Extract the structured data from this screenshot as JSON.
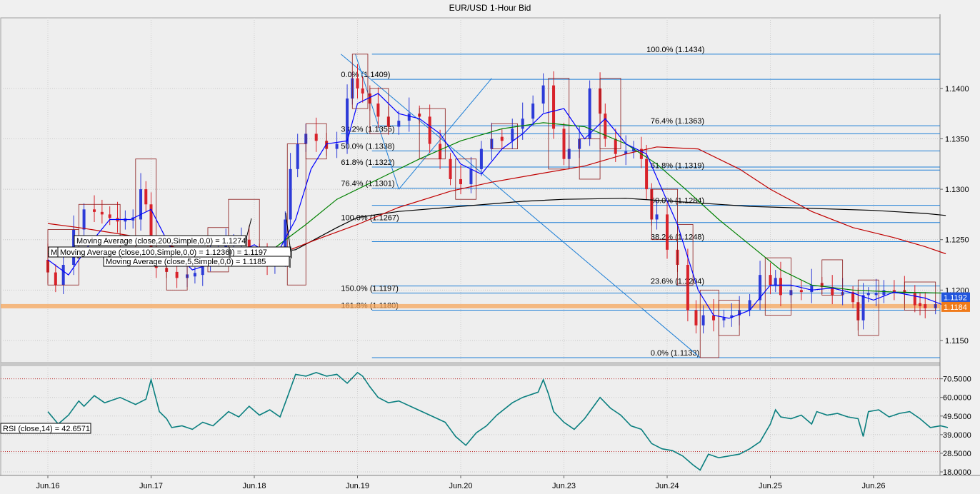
{
  "chart_data": {
    "type": "candlestick",
    "title": "EUR/USD 1-Hour Bid",
    "price_axis": {
      "range": [
        1.1128,
        1.147
      ],
      "ticks": [
        "1.1150",
        "1.1200",
        "1.1250",
        "1.1300",
        "1.1350",
        "1.1400"
      ],
      "current_label": "1.1184",
      "ma_label": "1.1192"
    },
    "rsi_axis": {
      "range": [
        16,
        78
      ],
      "ticks": [
        "18.0000",
        "28.5000",
        "39.0000",
        "49.5000",
        "60.0000",
        "70.5000"
      ],
      "levels": [
        70.5,
        29.5
      ]
    },
    "x_axis_labels": [
      "Jun.16",
      "Jun.17",
      "Jun.18",
      "Jun.19",
      "Jun.20",
      "Jun.23",
      "Jun.24",
      "Jun.25",
      "Jun.26"
    ],
    "x_range": [
      0,
      9.12
    ],
    "fib_lines": [
      {
        "price": 1.1434,
        "label": "100.0%  (1.1434)",
        "x_start": 3.14,
        "label_x": 5.8
      },
      {
        "price": 1.1409,
        "label": "0.0%  (1.1409)",
        "x_start": 3.14,
        "label_x": 2.84
      },
      {
        "price": 1.1363,
        "label": "76.4%  (1.1363)",
        "x_start": 3.14,
        "label_x": 5.84
      },
      {
        "price": 1.1355,
        "label": "38.2%  (1.1355)",
        "x_start": 2.84,
        "label_x": 2.84
      },
      {
        "price": 1.1338,
        "label": "50.0%  (1.1338)",
        "x_start": 3.14,
        "label_x": 2.84
      },
      {
        "price": 1.1322,
        "label": "61.8%  (1.1322)",
        "x_start": 3.14,
        "label_x": 2.84
      },
      {
        "price": 1.1319,
        "label": "61.8%  (1.1319)",
        "x_start": 5.8,
        "label_x": 5.84
      },
      {
        "price": 1.1301,
        "label": "76.4%  (1.1301)",
        "x_start": 3.14,
        "label_x": 2.84
      },
      {
        "price": 1.1284,
        "label": "50.0%  (1.1284)",
        "x_start": 3.14,
        "label_x": 5.84
      },
      {
        "price": 1.1267,
        "label": "100.0%  (1.1267)",
        "x_start": 3.14,
        "label_x": 2.84
      },
      {
        "price": 1.1248,
        "label": "38.2%  (1.1248)",
        "x_start": 3.14,
        "label_x": 5.84
      },
      {
        "price": 1.1204,
        "label": "23.6%  (1.1204)",
        "x_start": 3.14,
        "label_x": 5.84
      },
      {
        "price": 1.1197,
        "label": "150.0%  (1.1197)",
        "x_start": 3.14,
        "label_x": 2.84
      },
      {
        "price": 1.118,
        "label": "161.8%  (1.1180)",
        "x_start": 3.14,
        "label_x": 2.84
      },
      {
        "price": 1.1133,
        "label": "0.0%  (1.1133)",
        "x_start": 3.14,
        "label_x": 5.84
      }
    ],
    "close_path": [
      [
        0.0,
        1.123
      ],
      [
        0.15,
        1.1205
      ],
      [
        0.25,
        1.1225
      ],
      [
        0.35,
        1.126
      ],
      [
        0.45,
        1.128
      ],
      [
        0.6,
        1.1275
      ],
      [
        0.75,
        1.1268
      ],
      [
        0.9,
        1.127
      ],
      [
        0.95,
        1.13
      ],
      [
        1.0,
        1.1285
      ],
      [
        1.05,
        1.124
      ],
      [
        1.15,
        1.1222
      ],
      [
        1.25,
        1.1218
      ],
      [
        1.35,
        1.1212
      ],
      [
        1.5,
        1.1215
      ],
      [
        1.65,
        1.1238
      ],
      [
        1.8,
        1.1245
      ],
      [
        1.95,
        1.125
      ],
      [
        2.05,
        1.124
      ],
      [
        2.2,
        1.1225
      ],
      [
        2.3,
        1.123
      ],
      [
        2.35,
        1.127
      ],
      [
        2.42,
        1.132
      ],
      [
        2.5,
        1.1345
      ],
      [
        2.6,
        1.1355
      ],
      [
        2.7,
        1.1348
      ],
      [
        2.8,
        1.134
      ],
      [
        2.9,
        1.1345
      ],
      [
        2.95,
        1.139
      ],
      [
        3.0,
        1.141
      ],
      [
        3.05,
        1.14
      ],
      [
        3.12,
        1.1395
      ],
      [
        3.2,
        1.1385
      ],
      [
        3.3,
        1.1372
      ],
      [
        3.4,
        1.1362
      ],
      [
        3.5,
        1.1368
      ],
      [
        3.6,
        1.1375
      ],
      [
        3.7,
        1.1372
      ],
      [
        3.8,
        1.1345
      ],
      [
        3.9,
        1.133
      ],
      [
        4.0,
        1.131
      ],
      [
        4.1,
        1.1305
      ],
      [
        4.2,
        1.132
      ],
      [
        4.3,
        1.134
      ],
      [
        4.4,
        1.135
      ],
      [
        4.5,
        1.1348
      ],
      [
        4.6,
        1.136
      ],
      [
        4.7,
        1.137
      ],
      [
        4.8,
        1.1385
      ],
      [
        4.9,
        1.1403
      ],
      [
        5.0,
        1.136
      ],
      [
        5.05,
        1.133
      ],
      [
        5.15,
        1.134
      ],
      [
        5.25,
        1.135
      ],
      [
        5.35,
        1.14
      ],
      [
        5.4,
        1.1375
      ],
      [
        5.5,
        1.135
      ],
      [
        5.6,
        1.1335
      ],
      [
        5.75,
        1.134
      ],
      [
        5.8,
        1.133
      ],
      [
        5.85,
        1.13
      ],
      [
        5.9,
        1.127
      ],
      [
        6.0,
        1.1275
      ],
      [
        6.1,
        1.124
      ],
      [
        6.2,
        1.1225
      ],
      [
        6.28,
        1.118
      ],
      [
        6.35,
        1.1165
      ],
      [
        6.45,
        1.1175
      ],
      [
        6.55,
        1.117
      ],
      [
        6.7,
        1.1175
      ],
      [
        6.8,
        1.118
      ],
      [
        6.9,
        1.119
      ],
      [
        7.0,
        1.1215
      ],
      [
        7.05,
        1.1205
      ],
      [
        7.1,
        1.1212
      ],
      [
        7.2,
        1.1195
      ],
      [
        7.3,
        1.12
      ],
      [
        7.4,
        1.1198
      ],
      [
        7.5,
        1.1205
      ],
      [
        7.6,
        1.1203
      ],
      [
        7.7,
        1.1195
      ],
      [
        7.8,
        1.1198
      ],
      [
        7.85,
        1.1188
      ],
      [
        7.9,
        1.117
      ],
      [
        7.95,
        1.1195
      ],
      [
        8.1,
        1.1195
      ],
      [
        8.2,
        1.12
      ],
      [
        8.3,
        1.1198
      ],
      [
        8.4,
        1.1197
      ],
      [
        8.45,
        1.1185
      ],
      [
        8.5,
        1.1184
      ],
      [
        8.6,
        1.1182
      ],
      [
        8.68,
        1.1184
      ]
    ],
    "series": [
      {
        "name": "Moving Average (close,200,Simple,0,0) = 1.1274",
        "color": "#000000",
        "points": [
          [
            0.0,
            1.1236
          ],
          [
            0.6,
            1.1236
          ],
          [
            1.2,
            1.1233
          ],
          [
            1.8,
            1.1232
          ],
          [
            2.4,
            1.124
          ],
          [
            2.8,
            1.1262
          ],
          [
            3.0,
            1.1272
          ],
          [
            3.4,
            1.1278
          ],
          [
            4.0,
            1.1283
          ],
          [
            4.6,
            1.1288
          ],
          [
            5.0,
            1.129
          ],
          [
            5.6,
            1.1291
          ],
          [
            6.2,
            1.1287
          ],
          [
            6.8,
            1.1283
          ],
          [
            7.4,
            1.1281
          ],
          [
            8.0,
            1.1279
          ],
          [
            8.5,
            1.1276
          ],
          [
            8.7,
            1.1274
          ]
        ]
      },
      {
        "name": "Moving Average (close,100,Simple,0,0) = 1.1236",
        "color": "#c00000",
        "points": [
          [
            0.0,
            1.1266
          ],
          [
            0.3,
            1.1262
          ],
          [
            0.8,
            1.1254
          ],
          [
            1.4,
            1.1238
          ],
          [
            1.9,
            1.1237
          ],
          [
            2.3,
            1.1238
          ],
          [
            2.6,
            1.125
          ],
          [
            3.0,
            1.1265
          ],
          [
            3.4,
            1.1282
          ],
          [
            3.9,
            1.1298
          ],
          [
            4.3,
            1.1307
          ],
          [
            4.8,
            1.1316
          ],
          [
            5.2,
            1.1323
          ],
          [
            5.6,
            1.1335
          ],
          [
            5.9,
            1.1342
          ],
          [
            6.3,
            1.134
          ],
          [
            6.7,
            1.132
          ],
          [
            7.0,
            1.13
          ],
          [
            7.4,
            1.1278
          ],
          [
            7.8,
            1.1262
          ],
          [
            8.2,
            1.1252
          ],
          [
            8.5,
            1.1243
          ],
          [
            8.7,
            1.1236
          ]
        ]
      },
      {
        "name": "Moving Average (close,50,Simple,0,0) = 1.1197",
        "color": "#008000",
        "points": [
          [
            0.0,
            1.1238
          ],
          [
            0.5,
            1.1235
          ],
          [
            1.0,
            1.1237
          ],
          [
            1.4,
            1.124
          ],
          [
            1.8,
            1.1238
          ],
          [
            2.2,
            1.1242
          ],
          [
            2.5,
            1.1265
          ],
          [
            2.8,
            1.129
          ],
          [
            3.2,
            1.131
          ],
          [
            3.6,
            1.133
          ],
          [
            4.0,
            1.1348
          ],
          [
            4.4,
            1.136
          ],
          [
            4.8,
            1.1366
          ],
          [
            5.2,
            1.1362
          ],
          [
            5.6,
            1.1345
          ],
          [
            5.9,
            1.1325
          ],
          [
            6.2,
            1.1298
          ],
          [
            6.5,
            1.127
          ],
          [
            6.8,
            1.1245
          ],
          [
            7.1,
            1.122
          ],
          [
            7.4,
            1.1205
          ],
          [
            7.8,
            1.12
          ],
          [
            8.2,
            1.1198
          ],
          [
            8.7,
            1.1197
          ]
        ]
      },
      {
        "name": "Moving Average (close,5,Simple,0,0) = 1.1185",
        "color": "#0000ff",
        "points": [
          [
            0.0,
            1.123
          ],
          [
            0.2,
            1.1215
          ],
          [
            0.4,
            1.1245
          ],
          [
            0.6,
            1.127
          ],
          [
            0.8,
            1.127
          ],
          [
            1.0,
            1.128
          ],
          [
            1.2,
            1.124
          ],
          [
            1.4,
            1.122
          ],
          [
            1.7,
            1.123
          ],
          [
            2.0,
            1.1245
          ],
          [
            2.2,
            1.1232
          ],
          [
            2.4,
            1.127
          ],
          [
            2.55,
            1.132
          ],
          [
            2.7,
            1.1345
          ],
          [
            2.9,
            1.1348
          ],
          [
            3.0,
            1.1385
          ],
          [
            3.2,
            1.1395
          ],
          [
            3.4,
            1.1375
          ],
          [
            3.6,
            1.137
          ],
          [
            3.8,
            1.1355
          ],
          [
            4.0,
            1.1325
          ],
          [
            4.2,
            1.1315
          ],
          [
            4.4,
            1.134
          ],
          [
            4.6,
            1.1355
          ],
          [
            4.8,
            1.1375
          ],
          [
            5.0,
            1.138
          ],
          [
            5.2,
            1.135
          ],
          [
            5.4,
            1.137
          ],
          [
            5.6,
            1.1345
          ],
          [
            5.8,
            1.1335
          ],
          [
            5.95,
            1.13
          ],
          [
            6.1,
            1.1265
          ],
          [
            6.3,
            1.12
          ],
          [
            6.45,
            1.1175
          ],
          [
            6.6,
            1.1172
          ],
          [
            6.8,
            1.118
          ],
          [
            7.0,
            1.1205
          ],
          [
            7.2,
            1.1205
          ],
          [
            7.4,
            1.12
          ],
          [
            7.6,
            1.1202
          ],
          [
            7.8,
            1.1197
          ],
          [
            8.0,
            1.119
          ],
          [
            8.2,
            1.1198
          ],
          [
            8.5,
            1.1192
          ],
          [
            8.68,
            1.1185
          ]
        ]
      }
    ],
    "rsi_series": {
      "name": "RSI (close,14) = 42.6571",
      "points": [
        [
          0.0,
          52
        ],
        [
          0.1,
          45
        ],
        [
          0.2,
          50
        ],
        [
          0.3,
          58
        ],
        [
          0.35,
          55
        ],
        [
          0.45,
          61
        ],
        [
          0.55,
          57
        ],
        [
          0.7,
          60
        ],
        [
          0.85,
          56
        ],
        [
          0.95,
          59
        ],
        [
          1.0,
          70
        ],
        [
          1.08,
          52
        ],
        [
          1.15,
          48
        ],
        [
          1.2,
          43
        ],
        [
          1.3,
          44
        ],
        [
          1.4,
          42
        ],
        [
          1.5,
          46
        ],
        [
          1.6,
          44
        ],
        [
          1.75,
          52
        ],
        [
          1.85,
          49
        ],
        [
          1.95,
          55
        ],
        [
          2.05,
          50
        ],
        [
          2.15,
          53
        ],
        [
          2.25,
          49
        ],
        [
          2.32,
          60
        ],
        [
          2.4,
          73
        ],
        [
          2.5,
          72
        ],
        [
          2.6,
          74
        ],
        [
          2.7,
          72
        ],
        [
          2.8,
          73
        ],
        [
          2.9,
          68
        ],
        [
          3.0,
          74
        ],
        [
          3.05,
          72
        ],
        [
          3.12,
          66
        ],
        [
          3.2,
          60
        ],
        [
          3.3,
          57
        ],
        [
          3.4,
          58
        ],
        [
          3.55,
          54
        ],
        [
          3.7,
          50
        ],
        [
          3.85,
          46
        ],
        [
          3.95,
          38
        ],
        [
          4.05,
          33
        ],
        [
          4.15,
          40
        ],
        [
          4.25,
          44
        ],
        [
          4.35,
          50
        ],
        [
          4.5,
          57
        ],
        [
          4.6,
          60
        ],
        [
          4.75,
          63
        ],
        [
          4.8,
          70
        ],
        [
          4.85,
          62
        ],
        [
          4.9,
          52
        ],
        [
          5.0,
          46
        ],
        [
          5.1,
          42
        ],
        [
          5.2,
          48
        ],
        [
          5.3,
          56
        ],
        [
          5.35,
          60
        ],
        [
          5.45,
          54
        ],
        [
          5.55,
          50
        ],
        [
          5.65,
          44
        ],
        [
          5.75,
          42
        ],
        [
          5.85,
          34
        ],
        [
          5.95,
          31
        ],
        [
          6.05,
          30
        ],
        [
          6.15,
          27
        ],
        [
          6.25,
          22
        ],
        [
          6.32,
          19
        ],
        [
          6.4,
          28
        ],
        [
          6.5,
          26
        ],
        [
          6.6,
          27
        ],
        [
          6.7,
          28
        ],
        [
          6.8,
          31
        ],
        [
          6.9,
          35
        ],
        [
          7.0,
          45
        ],
        [
          7.05,
          53
        ],
        [
          7.1,
          49
        ],
        [
          7.2,
          48
        ],
        [
          7.3,
          50
        ],
        [
          7.4,
          45
        ],
        [
          7.45,
          52
        ],
        [
          7.55,
          50
        ],
        [
          7.65,
          51
        ],
        [
          7.75,
          49
        ],
        [
          7.85,
          48
        ],
        [
          7.9,
          38
        ],
        [
          7.95,
          52
        ],
        [
          8.05,
          53
        ],
        [
          8.15,
          49
        ],
        [
          8.25,
          51
        ],
        [
          8.35,
          52
        ],
        [
          8.45,
          48
        ],
        [
          8.55,
          43
        ],
        [
          8.65,
          44
        ],
        [
          8.72,
          43
        ]
      ]
    },
    "legends": [
      {
        "text": "Moving Average (close,200,Simple,0,0) = 1.1274"
      },
      {
        "text": "Moving Average (close,100,Simple,0,0) = 1.1236"
      },
      {
        "text": "Moving Average (close,5,Simple,0,0) = 1.1185"
      },
      {
        "text": "Mo"
      },
      {
        "text": "ple,0,0) = 1.1197"
      }
    ],
    "grid": true
  }
}
